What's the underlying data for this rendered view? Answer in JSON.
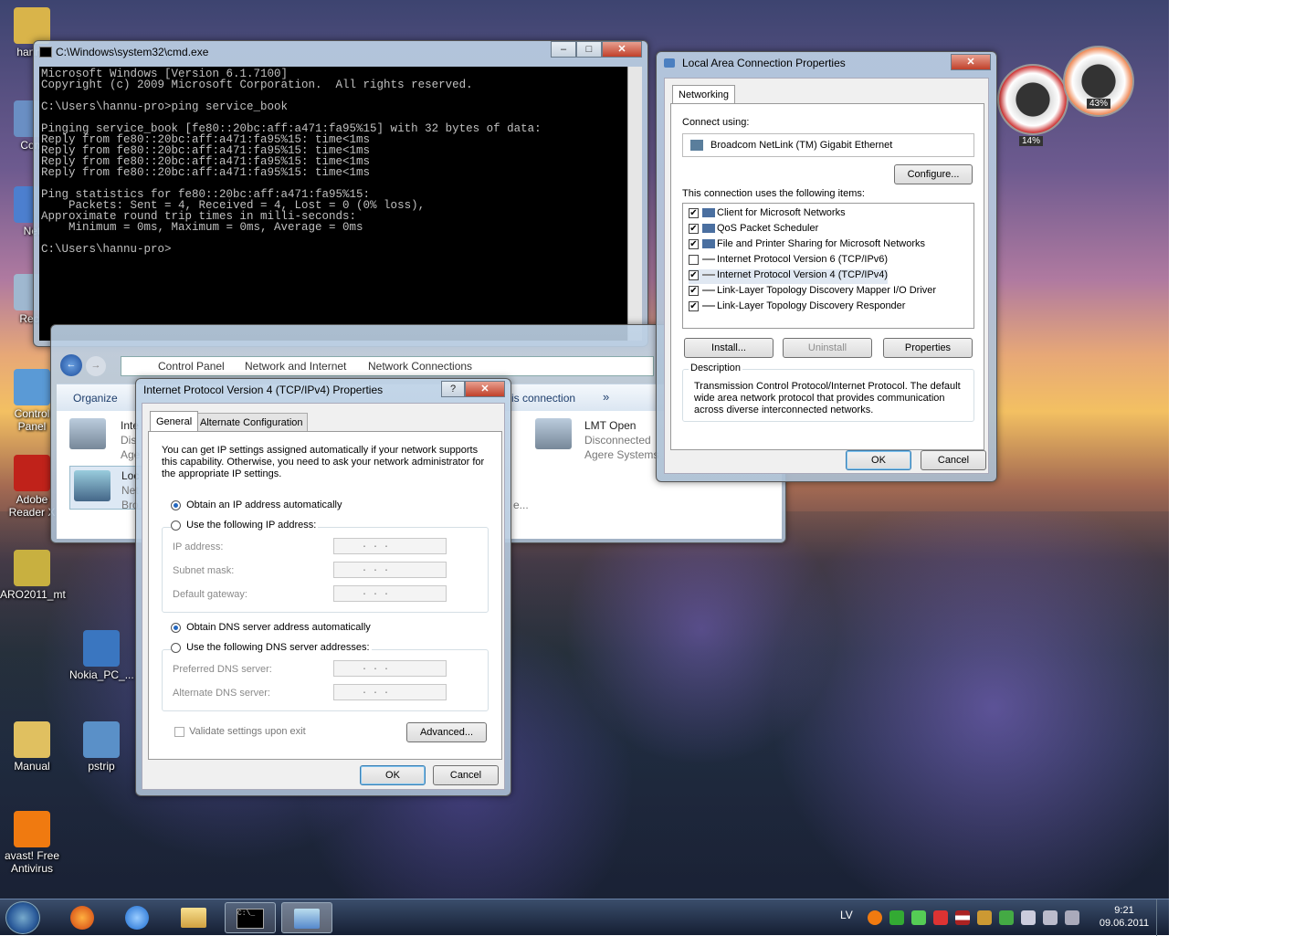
{
  "desktop_icons": [
    {
      "label": "hannu",
      "color": "#d9b44a"
    },
    {
      "label": "Com",
      "color": "#6a8fc4"
    },
    {
      "label": "Net",
      "color": "#4c7fcf"
    },
    {
      "label": "Recy",
      "color": "#9fb8d0"
    },
    {
      "label": "Control Panel",
      "color": "#5a9ad6"
    },
    {
      "label": "Adobe Reader X",
      "color": "#c0221a"
    },
    {
      "label": "ARO2011_mt",
      "color": "#c8b040"
    },
    {
      "label": "Nokia_PC_...",
      "color": "#3a76c0"
    },
    {
      "label": "Manual",
      "color": "#e0c060"
    },
    {
      "label": "pstrip",
      "color": "#5a90c8"
    },
    {
      "label": "avast! Free Antivirus",
      "color": "#f07a10"
    }
  ],
  "cmd": {
    "title": "C:\\Windows\\system32\\cmd.exe",
    "lines": [
      "Microsoft Windows [Version 6.1.7100]",
      "Copyright (c) 2009 Microsoft Corporation.  All rights reserved.",
      "",
      "C:\\Users\\hannu-pro>ping service_book",
      "",
      "Pinging service_book [fe80::20bc:aff:a471:fa95%15] with 32 bytes of data:",
      "Reply from fe80::20bc:aff:a471:fa95%15: time<1ms",
      "Reply from fe80::20bc:aff:a471:fa95%15: time<1ms",
      "Reply from fe80::20bc:aff:a471:fa95%15: time<1ms",
      "Reply from fe80::20bc:aff:a471:fa95%15: time<1ms",
      "",
      "Ping statistics for fe80::20bc:aff:a471:fa95%15:",
      "    Packets: Sent = 4, Received = 4, Lost = 0 (0% loss),",
      "Approximate round trip times in milli-seconds:",
      "    Minimum = 0ms, Maximum = 0ms, Average = 0ms",
      "",
      "C:\\Users\\hannu-pro>"
    ]
  },
  "explorer": {
    "breadcrumb": [
      "Control Panel",
      "Network and Internet",
      "Network Connections"
    ],
    "organize": "Organize",
    "toolbar_right": "is connection",
    "more": "»",
    "items": [
      {
        "name": "Inte",
        "line2": "Dis",
        "line3": "Age"
      },
      {
        "name": "Loc",
        "line2": "Net",
        "line3": "Bro"
      },
      {
        "name": "LMT Open",
        "line2": "Disconnected",
        "line3": "Agere Systems"
      }
    ],
    "ellipsis": "e..."
  },
  "lac": {
    "title": "Local Area Connection Properties",
    "tab": "Networking",
    "connect_using_label": "Connect using:",
    "adapter": "Broadcom NetLink (TM) Gigabit Ethernet",
    "configure": "Configure...",
    "items_label": "This connection uses the following items:",
    "items": [
      {
        "label": "Client for Microsoft Networks",
        "checked": true
      },
      {
        "label": "QoS Packet Scheduler",
        "checked": true
      },
      {
        "label": "File and Printer Sharing for Microsoft Networks",
        "checked": true
      },
      {
        "label": "Internet Protocol Version 6 (TCP/IPv6)",
        "checked": false
      },
      {
        "label": "Internet Protocol Version 4 (TCP/IPv4)",
        "checked": true
      },
      {
        "label": "Link-Layer Topology Discovery Mapper I/O Driver",
        "checked": true
      },
      {
        "label": "Link-Layer Topology Discovery Responder",
        "checked": true
      }
    ],
    "install": "Install...",
    "uninstall": "Uninstall",
    "properties": "Properties",
    "description_label": "Description",
    "description": "Transmission Control Protocol/Internet Protocol. The default wide area network protocol that provides communication across diverse interconnected networks.",
    "ok": "OK",
    "cancel": "Cancel"
  },
  "ipv4": {
    "title": "Internet Protocol Version 4 (TCP/IPv4) Properties",
    "help": "?",
    "tab_general": "General",
    "tab_alt": "Alternate Configuration",
    "intro": "You can get IP settings assigned automatically if your network supports this capability. Otherwise, you need to ask your network administrator for the appropriate IP settings.",
    "radio_auto_ip": "Obtain an IP address automatically",
    "radio_manual_ip": "Use the following IP address:",
    "ip_label": "IP address:",
    "mask_label": "Subnet mask:",
    "gateway_label": "Default gateway:",
    "radio_auto_dns": "Obtain DNS server address automatically",
    "radio_manual_dns": "Use the following DNS server addresses:",
    "pref_dns_label": "Preferred DNS server:",
    "alt_dns_label": "Alternate DNS server:",
    "ip_placeholder": ".     .     .",
    "validate": "Validate settings upon exit",
    "advanced": "Advanced...",
    "ok": "OK",
    "cancel": "Cancel"
  },
  "gadget": {
    "cpu": "14%",
    "mem": "43%"
  },
  "taskbar": {
    "lang": "LV",
    "time": "9:21",
    "date": "09.06.2011"
  }
}
